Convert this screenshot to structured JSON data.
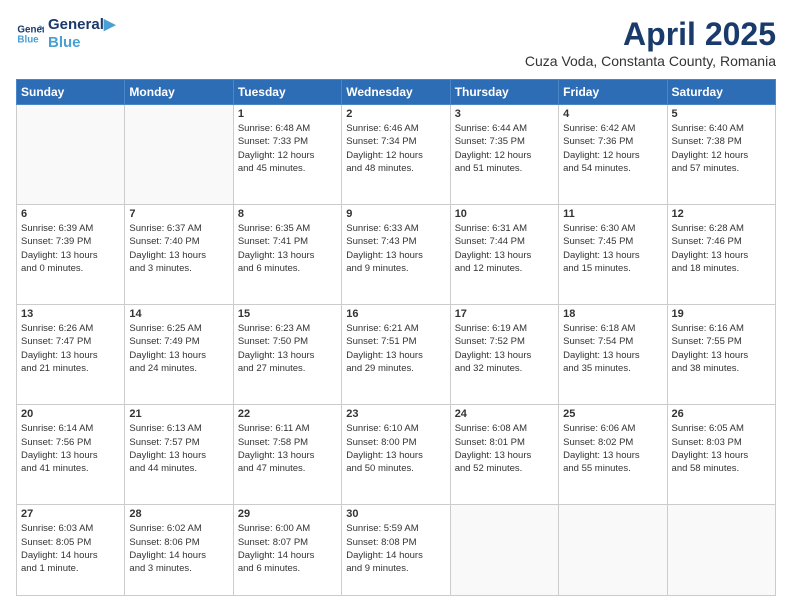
{
  "logo": {
    "line1": "General",
    "line2": "Blue"
  },
  "header": {
    "month_year": "April 2025",
    "location": "Cuza Voda, Constanta County, Romania"
  },
  "days_of_week": [
    "Sunday",
    "Monday",
    "Tuesday",
    "Wednesday",
    "Thursday",
    "Friday",
    "Saturday"
  ],
  "weeks": [
    [
      {
        "day": "",
        "info": ""
      },
      {
        "day": "",
        "info": ""
      },
      {
        "day": "1",
        "info": "Sunrise: 6:48 AM\nSunset: 7:33 PM\nDaylight: 12 hours\nand 45 minutes."
      },
      {
        "day": "2",
        "info": "Sunrise: 6:46 AM\nSunset: 7:34 PM\nDaylight: 12 hours\nand 48 minutes."
      },
      {
        "day": "3",
        "info": "Sunrise: 6:44 AM\nSunset: 7:35 PM\nDaylight: 12 hours\nand 51 minutes."
      },
      {
        "day": "4",
        "info": "Sunrise: 6:42 AM\nSunset: 7:36 PM\nDaylight: 12 hours\nand 54 minutes."
      },
      {
        "day": "5",
        "info": "Sunrise: 6:40 AM\nSunset: 7:38 PM\nDaylight: 12 hours\nand 57 minutes."
      }
    ],
    [
      {
        "day": "6",
        "info": "Sunrise: 6:39 AM\nSunset: 7:39 PM\nDaylight: 13 hours\nand 0 minutes."
      },
      {
        "day": "7",
        "info": "Sunrise: 6:37 AM\nSunset: 7:40 PM\nDaylight: 13 hours\nand 3 minutes."
      },
      {
        "day": "8",
        "info": "Sunrise: 6:35 AM\nSunset: 7:41 PM\nDaylight: 13 hours\nand 6 minutes."
      },
      {
        "day": "9",
        "info": "Sunrise: 6:33 AM\nSunset: 7:43 PM\nDaylight: 13 hours\nand 9 minutes."
      },
      {
        "day": "10",
        "info": "Sunrise: 6:31 AM\nSunset: 7:44 PM\nDaylight: 13 hours\nand 12 minutes."
      },
      {
        "day": "11",
        "info": "Sunrise: 6:30 AM\nSunset: 7:45 PM\nDaylight: 13 hours\nand 15 minutes."
      },
      {
        "day": "12",
        "info": "Sunrise: 6:28 AM\nSunset: 7:46 PM\nDaylight: 13 hours\nand 18 minutes."
      }
    ],
    [
      {
        "day": "13",
        "info": "Sunrise: 6:26 AM\nSunset: 7:47 PM\nDaylight: 13 hours\nand 21 minutes."
      },
      {
        "day": "14",
        "info": "Sunrise: 6:25 AM\nSunset: 7:49 PM\nDaylight: 13 hours\nand 24 minutes."
      },
      {
        "day": "15",
        "info": "Sunrise: 6:23 AM\nSunset: 7:50 PM\nDaylight: 13 hours\nand 27 minutes."
      },
      {
        "day": "16",
        "info": "Sunrise: 6:21 AM\nSunset: 7:51 PM\nDaylight: 13 hours\nand 29 minutes."
      },
      {
        "day": "17",
        "info": "Sunrise: 6:19 AM\nSunset: 7:52 PM\nDaylight: 13 hours\nand 32 minutes."
      },
      {
        "day": "18",
        "info": "Sunrise: 6:18 AM\nSunset: 7:54 PM\nDaylight: 13 hours\nand 35 minutes."
      },
      {
        "day": "19",
        "info": "Sunrise: 6:16 AM\nSunset: 7:55 PM\nDaylight: 13 hours\nand 38 minutes."
      }
    ],
    [
      {
        "day": "20",
        "info": "Sunrise: 6:14 AM\nSunset: 7:56 PM\nDaylight: 13 hours\nand 41 minutes."
      },
      {
        "day": "21",
        "info": "Sunrise: 6:13 AM\nSunset: 7:57 PM\nDaylight: 13 hours\nand 44 minutes."
      },
      {
        "day": "22",
        "info": "Sunrise: 6:11 AM\nSunset: 7:58 PM\nDaylight: 13 hours\nand 47 minutes."
      },
      {
        "day": "23",
        "info": "Sunrise: 6:10 AM\nSunset: 8:00 PM\nDaylight: 13 hours\nand 50 minutes."
      },
      {
        "day": "24",
        "info": "Sunrise: 6:08 AM\nSunset: 8:01 PM\nDaylight: 13 hours\nand 52 minutes."
      },
      {
        "day": "25",
        "info": "Sunrise: 6:06 AM\nSunset: 8:02 PM\nDaylight: 13 hours\nand 55 minutes."
      },
      {
        "day": "26",
        "info": "Sunrise: 6:05 AM\nSunset: 8:03 PM\nDaylight: 13 hours\nand 58 minutes."
      }
    ],
    [
      {
        "day": "27",
        "info": "Sunrise: 6:03 AM\nSunset: 8:05 PM\nDaylight: 14 hours\nand 1 minute."
      },
      {
        "day": "28",
        "info": "Sunrise: 6:02 AM\nSunset: 8:06 PM\nDaylight: 14 hours\nand 3 minutes."
      },
      {
        "day": "29",
        "info": "Sunrise: 6:00 AM\nSunset: 8:07 PM\nDaylight: 14 hours\nand 6 minutes."
      },
      {
        "day": "30",
        "info": "Sunrise: 5:59 AM\nSunset: 8:08 PM\nDaylight: 14 hours\nand 9 minutes."
      },
      {
        "day": "",
        "info": ""
      },
      {
        "day": "",
        "info": ""
      },
      {
        "day": "",
        "info": ""
      }
    ]
  ]
}
